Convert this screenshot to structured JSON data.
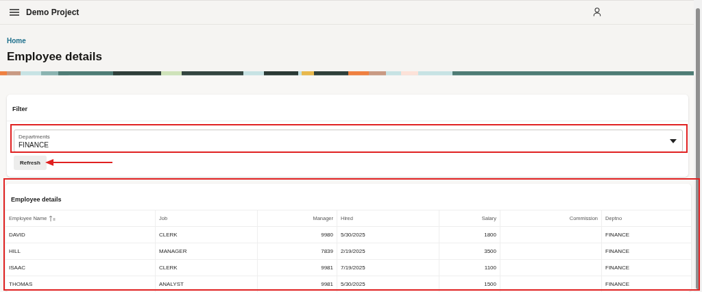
{
  "header": {
    "title": "Demo Project"
  },
  "breadcrumb": "Home",
  "page_title": "Employee details",
  "filter": {
    "title": "Filter",
    "field": {
      "label": "Departments",
      "value": "FINANCE"
    },
    "button": "Refresh"
  },
  "report": {
    "title": "Employee details",
    "columns": [
      {
        "label": "Employee Name",
        "kind": "text",
        "sorted": true
      },
      {
        "label": "Job",
        "kind": "text",
        "sorted": false
      },
      {
        "label": "Manager",
        "kind": "number",
        "sorted": false
      },
      {
        "label": "Hired",
        "kind": "text",
        "sorted": false
      },
      {
        "label": "Salary",
        "kind": "number",
        "sorted": false
      },
      {
        "label": "Commission",
        "kind": "number",
        "sorted": false
      },
      {
        "label": "Deptno",
        "kind": "text",
        "sorted": false
      }
    ],
    "rows": [
      [
        "DAVID",
        "CLERK",
        "9980",
        "5/30/2025",
        "1800",
        null,
        "FINANCE"
      ],
      [
        "HILL",
        "MANAGER",
        "7839",
        "2/19/2025",
        "3500",
        null,
        "FINANCE"
      ],
      [
        "ISAAC",
        "CLERK",
        "9981",
        "7/19/2025",
        "1100",
        null,
        "FINANCE"
      ],
      [
        "THOMAS",
        "ANALYST",
        "9981",
        "5/30/2025",
        "1500",
        null,
        "FINANCE"
      ]
    ]
  }
}
